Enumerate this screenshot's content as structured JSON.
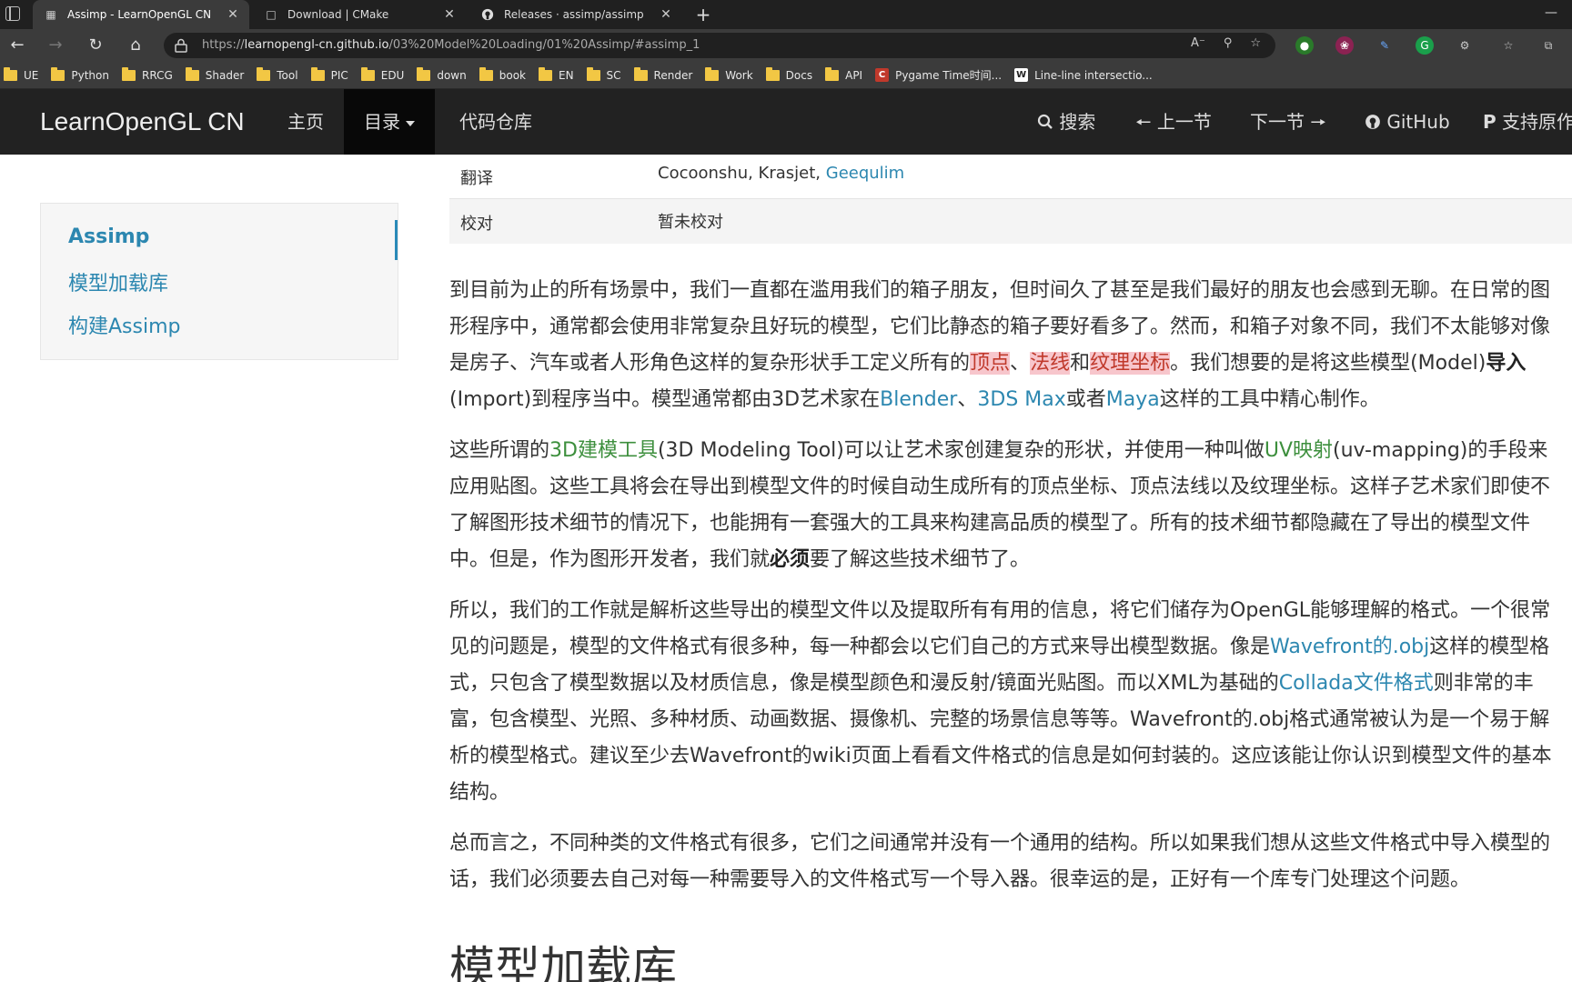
{
  "browser": {
    "tabs": [
      {
        "label": "Assimp - LearnOpenGL CN",
        "icon": "book-icon",
        "active": true
      },
      {
        "label": "Download | CMake",
        "icon": "page-icon",
        "active": false
      },
      {
        "label": "Releases · assimp/assimp",
        "icon": "github-icon",
        "active": false
      }
    ],
    "url_prefix": "https://",
    "url_host": "learnopengl-cn.github.io",
    "url_path": "/03%20Model%20Loading/01%20Assimp/#assimp_1",
    "bookmarks": [
      "UE",
      "Python",
      "RRCG",
      "Shader",
      "Tool",
      "PIC",
      "EDU",
      "down",
      "book",
      "EN",
      "SC",
      "Render",
      "Work",
      "Docs",
      "API",
      "Pygame Time时间...",
      "Line-line intersectio..."
    ]
  },
  "site": {
    "brand": "LearnOpenGL CN",
    "nav": {
      "home": "主页",
      "toc": "目录",
      "repo": "代码仓库",
      "search": "搜索",
      "prev": "上一节",
      "next": "下一节",
      "github": "GitHub",
      "support": "支持原作"
    }
  },
  "sidebar": {
    "items": [
      "Assimp",
      "模型加载库",
      "构建Assimp"
    ]
  },
  "meta": {
    "translate_label": "翻译",
    "translate_names": "Cocoonshu, Krasjet, ",
    "translate_link": "Geequlim",
    "review_label": "校对",
    "review_value": "暂未校对"
  },
  "content": {
    "p1": {
      "l1": "到目前为止的所有场景中，我们一直都在滥用我们的箱子朋友，但时间久了甚至是我们最好的朋友也会感到无聊。在日常的图",
      "l2": "形程序中，通常都会使用非常复杂且好玩的模型，它们比静态的箱子要好看多了。然而，和箱子对象不同，我们不太能够对像",
      "l3a": "是房子、汽车或者人形角色这样的复杂形状手工定义所有的",
      "hl1": "顶点",
      "sep1": "、",
      "hl2": "法线",
      "and": "和",
      "hl3": "纹理坐标",
      "l3b": "。我们想要的是将这些模型(Model)",
      "import_bold": "导入",
      "l4a": "(Import)到程序当中。模型通常都由3D艺术家在",
      "blender": "Blender",
      "sep2": "、",
      "max": "3DS Max",
      "or": "或者",
      "maya": "Maya",
      "l4b": "这样的工具中精心制作。"
    },
    "p2": {
      "l1a": "这些所谓的",
      "tool": "3D建模工具",
      "l1b": "(3D Modeling Tool)可以让艺术家创建复杂的形状，并使用一种叫做",
      "uv": "UV映射",
      "l1c": "(uv-mapping)的手段来",
      "l2": "应用贴图。这些工具将会在导出到模型文件的时候自动生成所有的顶点坐标、顶点法线以及纹理坐标。这样子艺术家们即使不",
      "l3": "了解图形技术细节的情况下，也能拥有一套强大的工具来构建高品质的模型了。所有的技术细节都隐藏在了导出的模型文件",
      "l4a": "中。但是，作为图形开发者，我们就",
      "must": "必须",
      "l4b": "要了解这些技术细节了。"
    },
    "p3": {
      "l1": "所以，我们的工作就是解析这些导出的模型文件以及提取所有有用的信息，将它们储存为OpenGL能够理解的格式。一个很常",
      "l2a": "见的问题是，模型的文件格式有很多种，每一种都会以它们自己的方式来导出模型数据。像是",
      "obj": "Wavefront的.obj",
      "l2b": "这样的模型格",
      "l3a": "式，只包含了模型数据以及材质信息，像是模型颜色和漫反射/镜面光贴图。而以XML为基础的",
      "collada": "Collada文件格式",
      "l3b": "则非常的丰",
      "l4": "富，包含模型、光照、多种材质、动画数据、摄像机、完整的场景信息等等。Wavefront的.obj格式通常被认为是一个易于解",
      "l5": "析的模型格式。建议至少去Wavefront的wiki页面上看看文件格式的信息是如何封装的。这应该能让你认识到模型文件的基本",
      "l6": "结构。"
    },
    "p4": {
      "l1": "总而言之，不同种类的文件格式有很多，它们之间通常并没有一个通用的结构。所以如果我们想从这些文件格式中导入模型的",
      "l2": "话，我们必须要去自己对每一种需要导入的文件格式写一个导入器。很幸运的是，正好有一个库专门处理这个问题。"
    },
    "heading": "模型加载库"
  }
}
